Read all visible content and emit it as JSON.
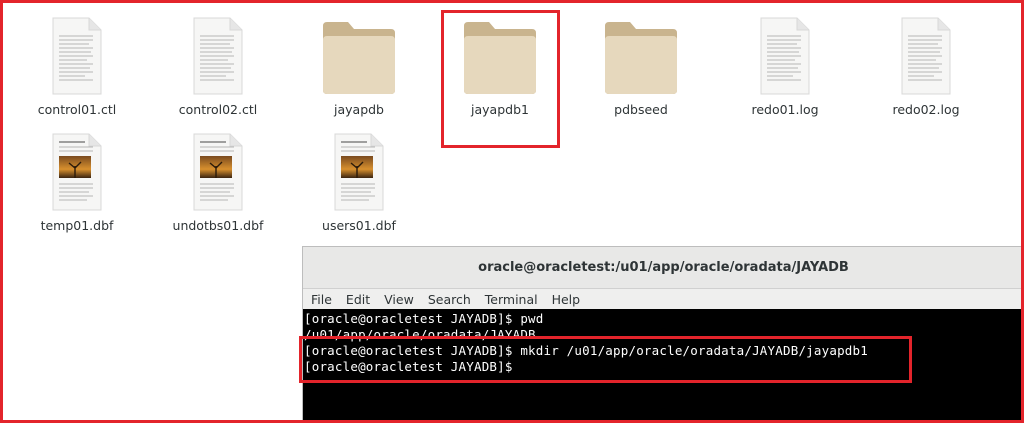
{
  "colors": {
    "accent": "#e3242b",
    "folder": "#e0d2b4",
    "terminal_bg": "#000000",
    "terminal_fg": "#ffffff"
  },
  "files": [
    {
      "name": "control01.ctl",
      "type": "text-file-icon"
    },
    {
      "name": "control02.ctl",
      "type": "text-file-icon"
    },
    {
      "name": "jayapdb",
      "type": "folder-icon"
    },
    {
      "name": "jayapdb1",
      "type": "folder-icon"
    },
    {
      "name": "pdbseed",
      "type": "folder-icon"
    },
    {
      "name": "redo01.log",
      "type": "text-file-icon"
    },
    {
      "name": "redo02.log",
      "type": "text-file-icon"
    },
    {
      "name": "temp01.dbf",
      "type": "image-doc-icon"
    },
    {
      "name": "undotbs01.dbf",
      "type": "image-doc-icon"
    },
    {
      "name": "users01.dbf",
      "type": "image-doc-icon"
    }
  ],
  "terminal": {
    "title": "oracle@oracletest:/u01/app/oracle/oradata/JAYADB",
    "menu": [
      "File",
      "Edit",
      "View",
      "Search",
      "Terminal",
      "Help"
    ],
    "lines": [
      "[oracle@oracletest JAYADB]$ pwd",
      "/u01/app/oracle/oradata/JAYADB",
      "[oracle@oracletest JAYADB]$ mkdir /u01/app/oracle/oradata/JAYADB/jayapdb1",
      "[oracle@oracletest JAYADB]$"
    ]
  }
}
